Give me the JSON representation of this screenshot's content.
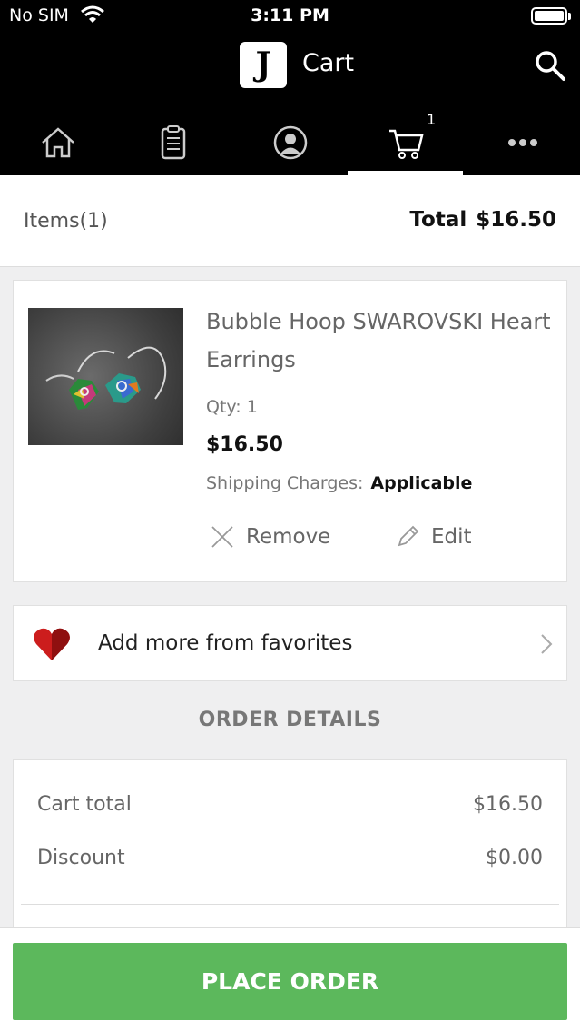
{
  "status": {
    "carrier": "No SIM",
    "time": "3:11 PM"
  },
  "header": {
    "logo_letter": "J",
    "title": "Cart"
  },
  "nav": {
    "tabs": [
      {
        "icon": "home-icon"
      },
      {
        "icon": "orders-icon"
      },
      {
        "icon": "account-icon"
      },
      {
        "icon": "cart-icon",
        "active": true,
        "badge": "1"
      },
      {
        "icon": "more-icon"
      }
    ]
  },
  "summary": {
    "items_label": "Items",
    "items_count": "(1)",
    "total_label": "Total",
    "total_value": "$16.50"
  },
  "product": {
    "name": "Bubble Hoop SWAROVSKI Heart Earrings",
    "qty": "Qty: 1",
    "price": "$16.50",
    "shipping_label": "Shipping Charges:",
    "shipping_value": "Applicable",
    "remove_label": "Remove",
    "edit_label": "Edit"
  },
  "favorites": {
    "label": "Add more from favorites"
  },
  "order_details": {
    "title": "ORDER DETAILS",
    "rows": [
      {
        "label": "Cart total",
        "value": "$16.50"
      },
      {
        "label": "Discount",
        "value": "$0.00"
      }
    ]
  },
  "place_order": {
    "label": "PLACE ORDER"
  },
  "colors": {
    "accent": "#5cb85c",
    "header": "#000000",
    "heart": "#cc1d1d"
  }
}
